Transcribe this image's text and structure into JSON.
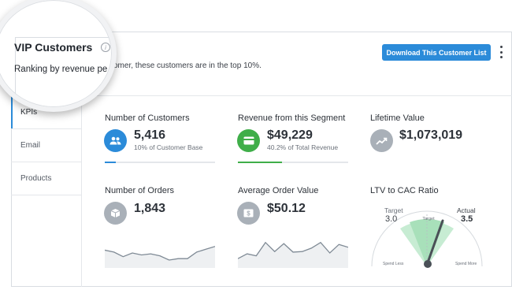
{
  "header": {
    "title": "VIP Customers",
    "subtitle_magnified": "Ranking by revenue pe",
    "subtitle_rest": "omer, these customers are in the top 10%.",
    "download_button": "Download This Customer List"
  },
  "sidebar": {
    "items": [
      {
        "label": "KPIs",
        "active": true
      },
      {
        "label": "Email",
        "active": false
      },
      {
        "label": "Products",
        "active": false
      }
    ]
  },
  "kpis": {
    "customers": {
      "title": "Number of Customers",
      "value": "5,416",
      "sub": "10%  of Customer Base",
      "progress": 0.1,
      "color": "#2b8bd9"
    },
    "revenue": {
      "title": "Revenue from this Segment",
      "value": "$49,229",
      "sub": "40.2% of Total Revenue",
      "progress": 0.402,
      "color": "#3fae49"
    },
    "ltv": {
      "title": "Lifetime Value",
      "value": "$1,073,019"
    },
    "orders": {
      "title": "Number of Orders",
      "value": "1,843"
    },
    "aov": {
      "title": "Average Order Value",
      "value": "$50.12"
    },
    "ltv_cac": {
      "title": "LTV to CAC Ratio",
      "target_label": "Target",
      "target_value": "3.0",
      "actual_label": "Actual",
      "actual_value": "3.5",
      "center_label": "Target",
      "left_label": "Spend Less",
      "right_label": "Spend More"
    }
  },
  "colors": {
    "accent": "#2b8bd9",
    "green": "#3fae49",
    "gray_icon": "#a9b0b8",
    "gauge_band": "#c7ecd3"
  },
  "sparklines": {
    "orders": [
      0.35,
      0.28,
      0.12,
      0.25,
      0.18,
      0.22,
      0.15,
      0.0,
      0.05,
      0.05,
      0.28,
      0.38,
      0.48
    ],
    "aov": [
      0.05,
      0.22,
      0.15,
      0.62,
      0.3,
      0.58,
      0.28,
      0.3,
      0.42,
      0.62,
      0.25,
      0.55,
      0.45
    ]
  }
}
